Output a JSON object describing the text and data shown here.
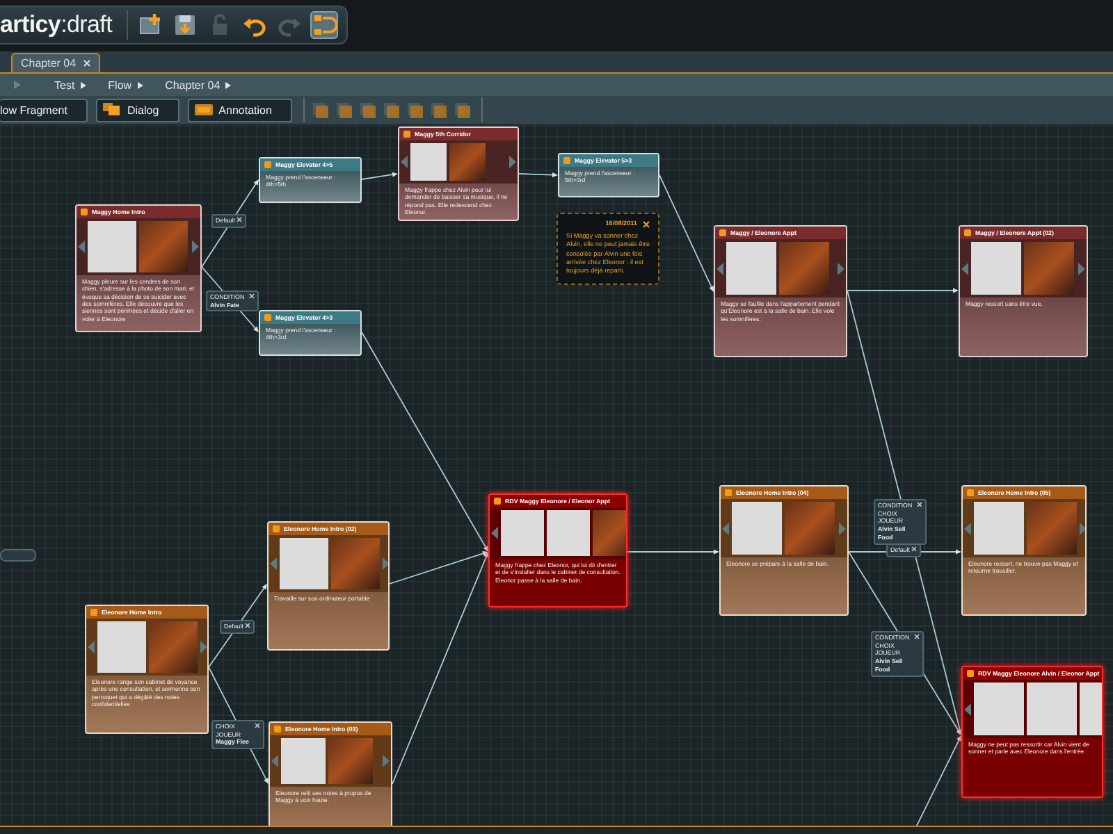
{
  "app": {
    "logo": "**articy**:draft"
  },
  "toolbar": [
    {
      "kind": "new",
      "disabled": false,
      "selected": false
    },
    {
      "kind": "save",
      "disabled": false,
      "selected": false
    },
    {
      "kind": "lock",
      "disabled": true,
      "selected": false
    },
    {
      "kind": "undo",
      "disabled": false,
      "selected": false
    },
    {
      "kind": "redo",
      "disabled": true,
      "selected": false
    },
    {
      "kind": "flow",
      "disabled": false,
      "selected": true
    }
  ],
  "tabs": [
    {
      "label": "Chapter 04",
      "selected": true
    }
  ],
  "breadcrumb": [
    "Test",
    "Flow",
    "Chapter 04"
  ],
  "palette": [
    {
      "label": "low Fragment",
      "kind": "fragment"
    },
    {
      "label": "Dialog",
      "kind": "dialog"
    },
    {
      "label": "Annotation",
      "kind": "annotation"
    }
  ],
  "nodes": [
    {
      "title": "Maggy Home Intro",
      "color": "#7a2c2c",
      "highlighted": false,
      "images": [
        {
          "kind": "portrait"
        },
        {
          "kind": "scene"
        }
      ],
      "text": "Maggy pleure sur les cendres de son chien, s'adresse à la photo de son mari, et évoque sa décision de se suicider avec des somnifères. Elle découvre que les siennes sont périmées et décide d'aller en voler à Eleonore"
    },
    {
      "title": "Maggy Elevator 4>5",
      "color": "#3d7a84",
      "highlighted": false,
      "text": "Maggy prend l'ascenseur : 4th>5th"
    },
    {
      "title": "Maggy 5th Corridor",
      "color": "#7a2c2c",
      "highlighted": false,
      "images": [
        {
          "kind": "portrait"
        },
        {
          "kind": "scene"
        }
      ],
      "text": "Maggy frappe chez Alvin pour lui demander de baisser sa musique, il ne répond pas. Elle redescend chez Eleonor."
    },
    {
      "title": "Maggy Elevator 5>3",
      "color": "#3d7a84",
      "highlighted": false,
      "text": "Maggy prend l'ascenseur : 5th>3rd"
    },
    {
      "title": "Maggy Elevator 4>3",
      "color": "#3d7a84",
      "highlighted": false,
      "text": "Maggy prend l'ascenseur : 4th>3rd"
    },
    {
      "title": "Maggy / Eleonore Appt",
      "color": "#7a2c2c",
      "highlighted": false,
      "images": [
        {
          "kind": "portrait"
        },
        {
          "kind": "scene"
        }
      ],
      "text": "Maggy se faufile dans l'appartement pendant qu'Eleonore est à la salle de bain. Elle vole les somnifères."
    },
    {
      "title": "Maggy / Eleonore Appt (02)",
      "color": "#7a2c2c",
      "highlighted": false,
      "images": [
        {
          "kind": "portrait"
        },
        {
          "kind": "scene"
        }
      ],
      "text": "Maggy ressort sans être vue."
    },
    {
      "title": "RDV Maggy Eleonore / Eleonor Appt",
      "color": "#8c0000",
      "highlighted": true,
      "images": [
        {
          "kind": "portrait"
        },
        {
          "kind": "portrait"
        },
        {
          "kind": "scene"
        }
      ],
      "text": "Maggy frappe chez Eleonor, qui lui dit d'entrer et de s'installer dans le cabinet de consultation. Eleonor passe à la salle de bain."
    },
    {
      "title": "Eleonore Home Intro (04)",
      "color": "#a65a18",
      "highlighted": false,
      "images": [
        {
          "kind": "portrait"
        },
        {
          "kind": "scene"
        }
      ],
      "text": "Eleonore se prépare à la salle de bain."
    },
    {
      "title": "Eleonore Home Intro (05)",
      "color": "#a65a18",
      "highlighted": false,
      "images": [
        {
          "kind": "portrait"
        },
        {
          "kind": "scene"
        }
      ],
      "text": "Eleonore ressort, ne trouve pas Maggy et retourne travailler."
    },
    {
      "title": "Eleonore Home Intro (02)",
      "color": "#a65a18",
      "highlighted": false,
      "images": [
        {
          "kind": "portrait"
        },
        {
          "kind": "scene"
        }
      ],
      "text": "Travaille sur son ordinateur portable"
    },
    {
      "title": "Eleonore Home Intro",
      "color": "#a65a18",
      "highlighted": false,
      "images": [
        {
          "kind": "portrait"
        },
        {
          "kind": "scene"
        }
      ],
      "text": "Eleonore range son cabinet de voyance après une consultation, et sermonne son perroquet qui a dégâté des notes confidentielles"
    },
    {
      "title": "RDV Maggy Eleonore Alvin / Eleonor Appt",
      "color": "#8c0000",
      "highlighted": true,
      "images": [
        {
          "kind": "portrait"
        },
        {
          "kind": "portrait"
        },
        {
          "kind": "portrait"
        }
      ],
      "text": "Maggy ne peut pas ressortir car Alvin vient de sonner et parle avec Eleonore dans l'entrée."
    },
    {
      "title": "Eleonore Home Intro (03)",
      "color": "#a65a18",
      "highlighted": false,
      "images": [
        {
          "kind": "portrait"
        },
        {
          "kind": "scene"
        }
      ],
      "text": "Eleonore relit ses notes à propos de Maggy à voix haute."
    }
  ],
  "annotation": {
    "date": "16/08/2011",
    "text": "Si Maggy va sonner chez Alvin, elle ne peut jamais être consolée par Alvin une fois arrivée chez Eleonor : il est toujours déjà reparti."
  },
  "connection_labels": [
    {
      "lines": [
        "Default"
      ]
    },
    {
      "lines": [
        "CONDITION",
        "Alvin Fate"
      ]
    },
    {
      "lines": [
        "CONDITION CHOIX JOUEUR",
        "Alvin Sell Food"
      ]
    },
    {
      "lines": [
        "Default"
      ]
    },
    {
      "lines": [
        "Default"
      ]
    },
    {
      "lines": [
        "CONDITION CHOIX JOUEUR",
        "Alvin Sell Food"
      ]
    },
    {
      "lines": [
        "CHOIX JOUEUR",
        "Maggy Flee"
      ]
    }
  ]
}
